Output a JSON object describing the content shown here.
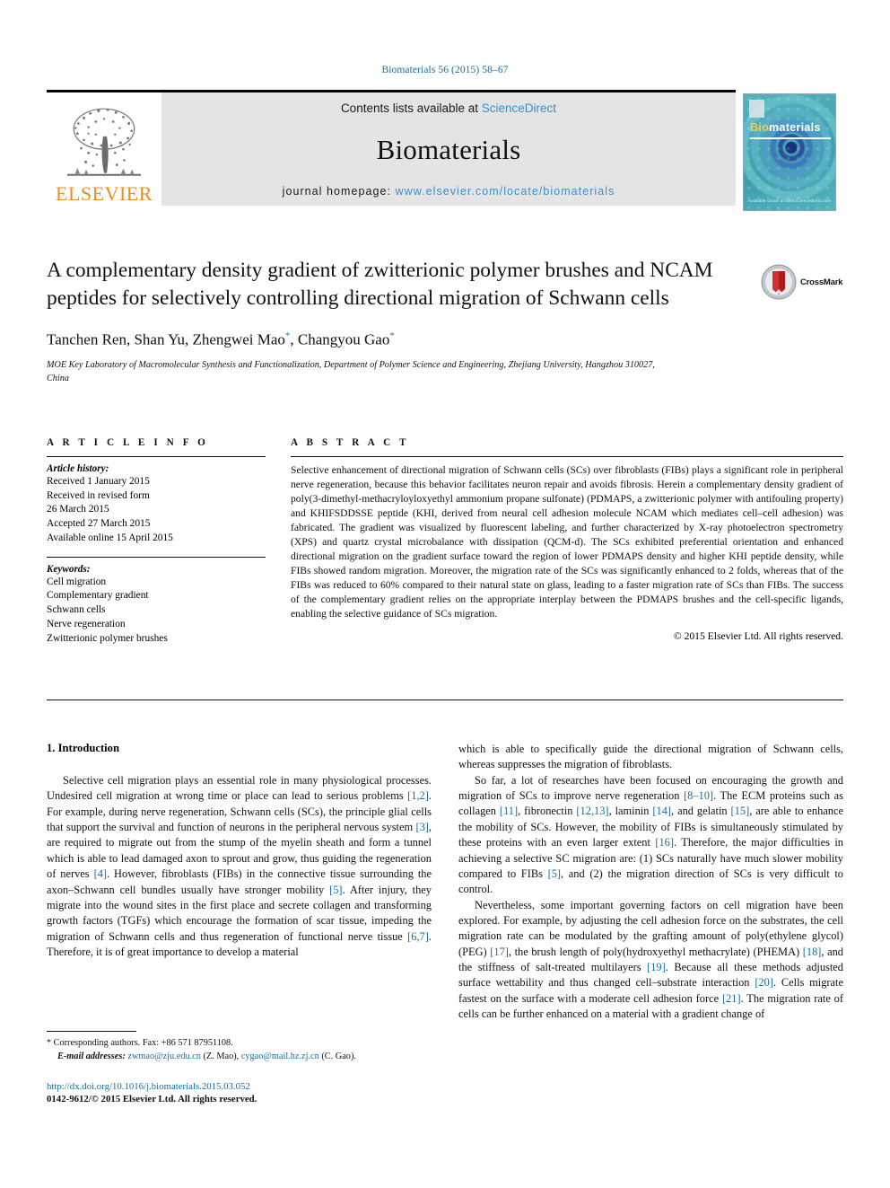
{
  "running_head": "Biomaterials 56 (2015) 58–67",
  "masthead": {
    "publisher_logo_text": "ELSEVIER",
    "contents_prefix": "Contents lists available at ",
    "contents_link": "ScienceDirect",
    "journal_name": "Biomaterials",
    "homepage_prefix": "journal homepage: ",
    "homepage_link": "www.elsevier.com/locate/biomaterials"
  },
  "cover": {
    "title_bio": "Bio",
    "title_rest": "materials",
    "footer_text": "Available online at www.sciencedirect.com"
  },
  "crossmark": {
    "label": "CrossMark"
  },
  "article": {
    "title": "A complementary density gradient of zwitterionic polymer brushes and NCAM peptides for selectively controlling directional migration of Schwann cells",
    "authors_plain": "Tanchen Ren, Shan Yu, Zhengwei Mao",
    "authors": [
      {
        "name": "Tanchen Ren",
        "star": false
      },
      {
        "name": "Shan Yu",
        "star": false
      },
      {
        "name": "Zhengwei Mao",
        "star": true
      },
      {
        "name": "Changyou Gao",
        "star": true
      }
    ],
    "affiliation": "MOE Key Laboratory of Macromolecular Synthesis and Functionalization, Department of Polymer Science and Engineering, Zhejiang University, Hangzhou 310027, China"
  },
  "info": {
    "section_label": "A R T I C L E  I N F O",
    "history_head": "Article history:",
    "history": [
      "Received 1 January 2015",
      "Received in revised form",
      "26 March 2015",
      "Accepted 27 March 2015",
      "Available online 15 April 2015"
    ],
    "keywords_head": "Keywords:",
    "keywords": [
      "Cell migration",
      "Complementary gradient",
      "Schwann cells",
      "Nerve regeneration",
      "Zwitterionic polymer brushes"
    ]
  },
  "abstract": {
    "section_label": "A B S T R A C T",
    "text": "Selective enhancement of directional migration of Schwann cells (SCs) over fibroblasts (FIBs) plays a significant role in peripheral nerve regeneration, because this behavior facilitates neuron repair and avoids fibrosis. Herein a complementary density gradient of poly(3-dimethyl-methacryloyloxyethyl ammonium propane sulfonate) (PDMAPS, a zwitterionic polymer with antifouling property) and KHIFSDDSSE peptide (KHI, derived from neural cell adhesion molecule NCAM which mediates cell–cell adhesion) was fabricated. The gradient was visualized by fluorescent labeling, and further characterized by X-ray photoelectron spectrometry (XPS) and quartz crystal microbalance with dissipation (QCM-d). The SCs exhibited preferential orientation and enhanced directional migration on the gradient surface toward the region of lower PDMAPS density and higher KHI peptide density, while FIBs showed random migration. Moreover, the migration rate of the SCs was significantly enhanced to 2 folds, whereas that of the FIBs was reduced to 60% compared to their natural state on glass, leading to a faster migration rate of SCs than FIBs. The success of the complementary gradient relies on the appropriate interplay between the PDMAPS brushes and the cell-specific ligands, enabling the selective guidance of SCs migration.",
    "copyright": "© 2015 Elsevier Ltd. All rights reserved."
  },
  "body": {
    "section_heading": "1. Introduction",
    "left_paragraphs": [
      "Selective cell migration plays an essential role in many physiological processes. Undesired cell migration at wrong time or place can lead to serious problems [1,2]. For example, during nerve regeneration, Schwann cells (SCs), the principle glial cells that support the survival and function of neurons in the peripheral nervous system [3], are required to migrate out from the stump of the myelin sheath and form a tunnel which is able to lead damaged axon to sprout and grow, thus guiding the regeneration of nerves [4]. However, fibroblasts (FIBs) in the connective tissue surrounding the axon–Schwann cell bundles usually have stronger mobility [5]. After injury, they migrate into the wound sites in the first place and secrete collagen and transforming growth factors (TGFs) which encourage the formation of scar tissue, impeding the migration of Schwann cells and thus regeneration of functional nerve tissue [6,7]. Therefore, it is of great importance to develop a material"
    ],
    "right_paragraphs": [
      "which is able to specifically guide the directional migration of Schwann cells, whereas suppresses the migration of fibroblasts.",
      "So far, a lot of researches have been focused on encouraging the growth and migration of SCs to improve nerve regeneration [8–10]. The ECM proteins such as collagen [11], fibronectin [12,13], laminin [14], and gelatin [15], are able to enhance the mobility of SCs. However, the mobility of FIBs is simultaneously stimulated by these proteins with an even larger extent [16]. Therefore, the major difficulties in achieving a selective SC migration are: (1) SCs naturally have much slower mobility compared to FIBs [5], and (2) the migration direction of SCs is very difficult to control.",
      "Nevertheless, some important governing factors on cell migration have been explored. For example, by adjusting the cell adhesion force on the substrates, the cell migration rate can be modulated by the grafting amount of poly(ethylene glycol) (PEG) [17], the brush length of poly(hydroxyethyl methacrylate) (PHEMA) [18], and the stiffness of salt-treated multilayers [19]. Because all these methods adjusted surface wettability and thus changed cell–substrate interaction [20]. Cells migrate fastest on the surface with a moderate cell adhesion force [21]. The migration rate of cells can be further enhanced on a material with a gradient change of"
    ]
  },
  "footnote": {
    "star": "*",
    "corresponding": "Corresponding authors. Fax: +86 571 87951108.",
    "email_label": "E-mail addresses:",
    "email1": "zwmao@zju.edu.cn",
    "email1_who": "(Z. Mao),",
    "email2": "cygao@mail.hz.zj.cn",
    "email2_who": "(C. Gao)."
  },
  "footer": {
    "doi": "http://dx.doi.org/10.1016/j.biomaterials.2015.03.052",
    "issn": "0142-9612/© 2015 Elsevier Ltd. All rights reserved."
  },
  "colors": {
    "link_blue": "#1a6ba0",
    "sd_blue": "#3e8fc4",
    "elsevier_orange": "#f08d1d",
    "masthead_gray": "#e4e4e4",
    "cover_teal": "#3fa9b8"
  }
}
